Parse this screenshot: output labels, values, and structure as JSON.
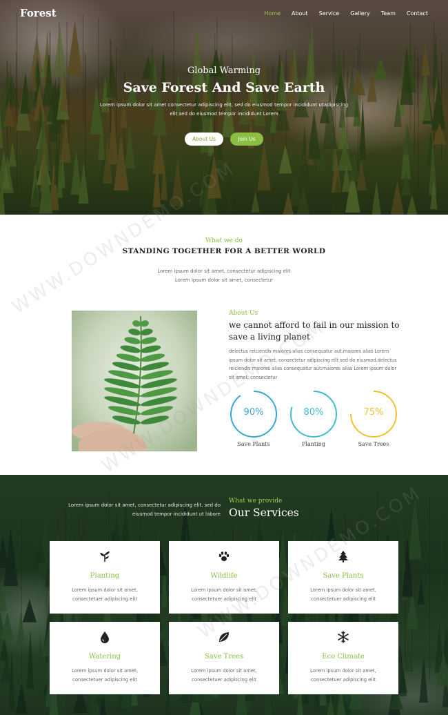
{
  "brand": {
    "logo": "Forest",
    "accent": "#8bbf43"
  },
  "nav": {
    "items": [
      {
        "label": "Home",
        "active": true
      },
      {
        "label": "About"
      },
      {
        "label": "Service"
      },
      {
        "label": "Gallery"
      },
      {
        "label": "Team"
      },
      {
        "label": "Contact"
      }
    ]
  },
  "hero": {
    "subtitle": "Global Warming",
    "title": "Save Forest And Save Earth",
    "text": "Lorem ipsum dolor sit amet consectetur adipiscing elit, sed do eiusmod tempor incididunt utadipiscing elit sed do eiusmod tempor incididunt Lorem",
    "btn_about": "About Us",
    "btn_join": "Join Us"
  },
  "what_we_do": {
    "small": "What we do",
    "title": "STANDING TOGETHER FOR A BETTER WORLD",
    "line1": "Lorem ipsum dolor sit amet, consectetur adipiscing elit",
    "line2": "Lorem ipsum dolor sit amet, consectetur"
  },
  "about": {
    "small": "About Us",
    "title": "we cannot afford to fail in our mission to save a living planet",
    "text": "delectus reiciendis maiores alias consequatur aut.maiores alias Lorem ipsum dolor sit amet, consectetur adipiscing elit sed do eiusmod.delectus reiciendis maiores alias consequatur aut.maiores alias Lorem ipsum dolor sit amet, consectetur",
    "stats": [
      {
        "value": "90%",
        "label": "Save Plants",
        "fraction": 0.9,
        "color": "#3aa6d6"
      },
      {
        "value": "80%",
        "label": "Planting",
        "fraction": 0.8,
        "color": "#3fbccf"
      },
      {
        "value": "75%",
        "label": "Save Trees",
        "fraction": 0.75,
        "color": "#f2c230"
      }
    ]
  },
  "services": {
    "left_text": "Lorem ipsum dolor sit amet, consectetur adipiscing elit, sed do eiusmod tempor incididunt ut labore",
    "small": "What we provide",
    "title": "Our Services",
    "cards": [
      {
        "title": "Planting",
        "icon": "sprout-icon",
        "line1": "Lorem ipsum dolor sit amet,",
        "line2": "consectetuer adipiscing elit"
      },
      {
        "title": "Wildlife",
        "icon": "paw-icon",
        "line1": "Lorem ipsum dolor sit amet,",
        "line2": "consectetuer adipiscing elit"
      },
      {
        "title": "Save Plants",
        "icon": "tree-icon",
        "line1": "Lorem ipsum dolor sit amet,",
        "line2": "consectetuer adipiscing elit"
      },
      {
        "title": "Watering",
        "icon": "water-drop-icon",
        "line1": "Lorem ipsum dolor sit amet,",
        "line2": "consectetuer adipiscing elit"
      },
      {
        "title": "Save Trees",
        "icon": "leaf-icon",
        "line1": "Lorem ipsum dolor sit amet,",
        "line2": "consectetuer adipiscing elit"
      },
      {
        "title": "Eco Climate",
        "icon": "snowflake-icon",
        "line1": "Lorem ipsum dolor sit amet,",
        "line2": "consectetuer adipiscing elit"
      }
    ]
  },
  "watermark": "WWW.DOWNDEMO.COM"
}
